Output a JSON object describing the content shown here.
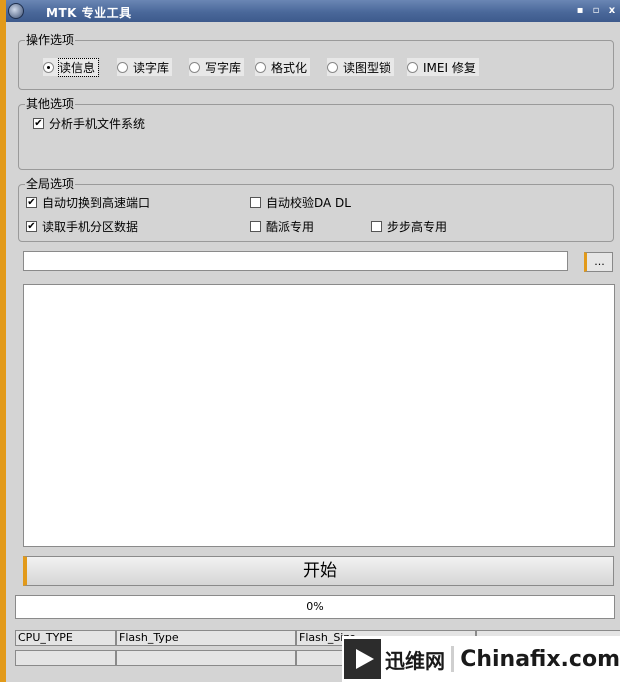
{
  "window": {
    "title": "MTK 专业工具",
    "controls": [
      "▪",
      "▫",
      "x"
    ]
  },
  "operations": {
    "title": "操作选项",
    "options": [
      {
        "label": "读信息",
        "selected": true
      },
      {
        "label": "读字库",
        "selected": false
      },
      {
        "label": "写字库",
        "selected": false
      },
      {
        "label": "格式化",
        "selected": false
      },
      {
        "label": "读图型锁",
        "selected": false
      },
      {
        "label": "IMEI 修复",
        "selected": false
      }
    ]
  },
  "other": {
    "title": "其他选项",
    "options": [
      {
        "label": "分析手机文件系统",
        "checked": true
      }
    ]
  },
  "global": {
    "title": "全局选项",
    "options": [
      {
        "label": "自动切换到高速端口",
        "checked": true
      },
      {
        "label": "自动校验DA DL",
        "checked": false
      },
      {
        "label": "读取手机分区数据",
        "checked": true
      },
      {
        "label": "酷派专用",
        "checked": false
      },
      {
        "label": "步步高专用",
        "checked": false
      }
    ]
  },
  "file": {
    "path_value": "",
    "browse_label": "..."
  },
  "start_label": "开始",
  "progress": {
    "percent": 0,
    "text": "0%"
  },
  "status": {
    "headers": [
      "CPU_TYPE",
      "Flash_Type",
      "Flash_Size",
      ""
    ],
    "values": [
      "",
      "",
      "",
      ""
    ]
  },
  "watermark": {
    "cn": "迅维网",
    "en": "Chinafix.com"
  },
  "colors": {
    "accent": "#e29a1a",
    "title_bar": "#4a689a",
    "panel": "#d4d4d4"
  }
}
